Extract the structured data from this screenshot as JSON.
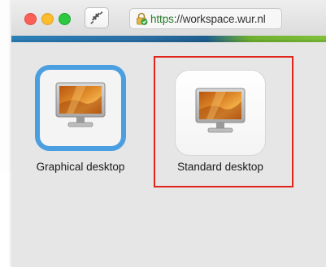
{
  "window": {
    "url_secure": "https",
    "url_rest": "://workspace.wur.nl"
  },
  "icons": {
    "close": "close-window-icon",
    "minimize": "minimize-window-icon",
    "zoom": "zoom-window-icon",
    "plug": "plug-icon",
    "lock": "secure-lock-icon",
    "desktop": "desktop-monitor-icon"
  },
  "colors": {
    "selected_border": "#4a9fe0",
    "highlight": "#e0241b",
    "url_secure": "#2a7a2a"
  },
  "desktops": [
    {
      "label": "Graphical desktop",
      "selected": true
    },
    {
      "label": "Standard desktop",
      "selected": false,
      "highlighted": true
    }
  ]
}
